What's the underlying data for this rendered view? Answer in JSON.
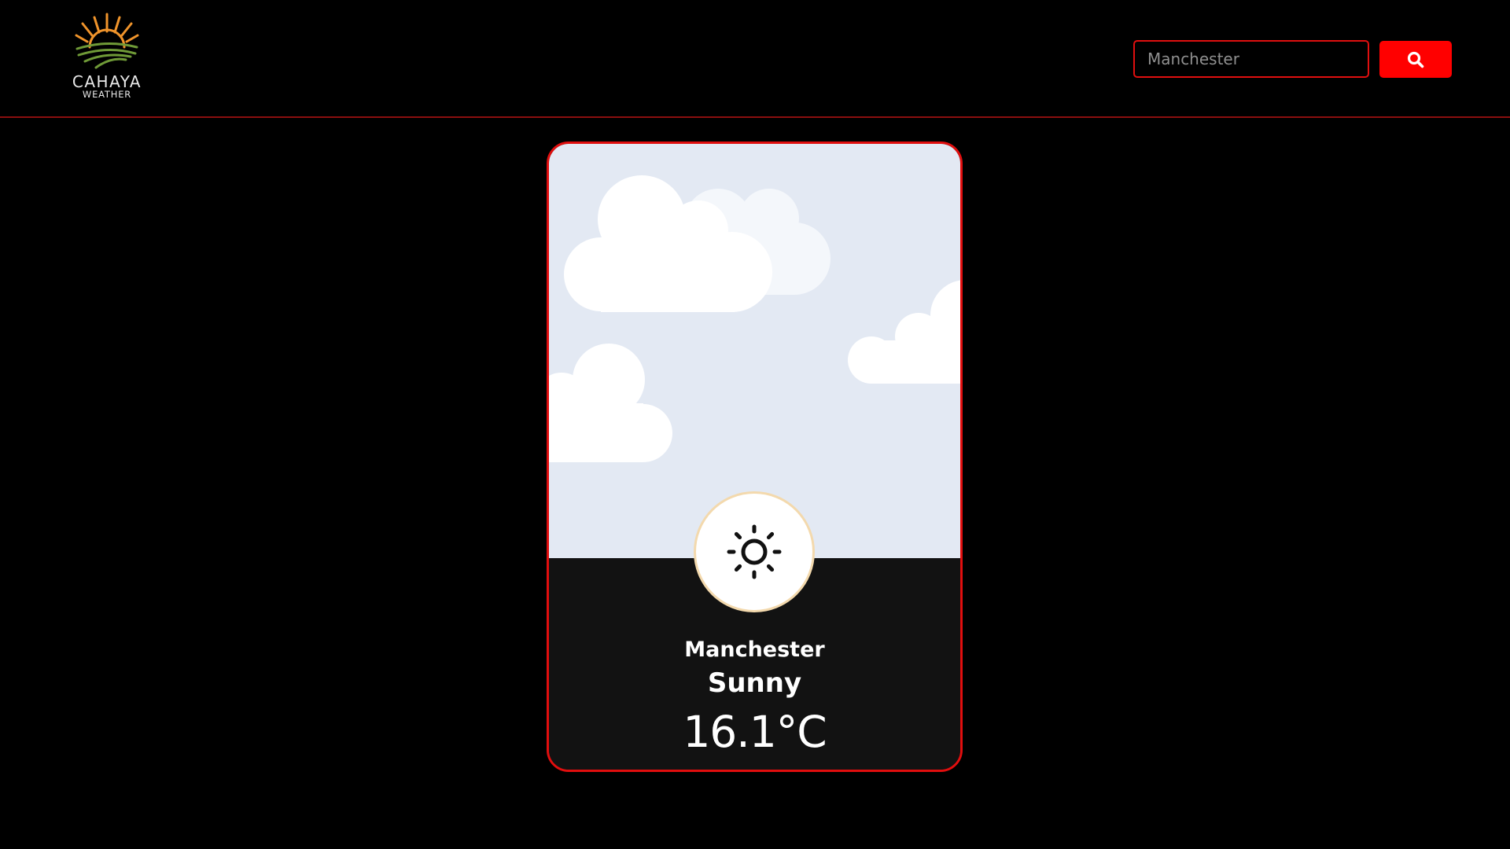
{
  "brand": {
    "name": "CAHAYA",
    "tagline": "WEATHER",
    "sun_color": "#f0942b",
    "field_color": "#6f9a37"
  },
  "search": {
    "placeholder": "Manchester",
    "value": "",
    "button_icon": "search-icon"
  },
  "weather_card": {
    "city": "Manchester",
    "condition": "Sunny",
    "temperature": "16.1°C",
    "condition_icon": "sun-icon",
    "sky_color": "#e3e9f3",
    "border_color": "#e10e0e"
  },
  "colors": {
    "accent": "#ff0000",
    "background": "#000000",
    "divider": "#8b0f0f"
  }
}
